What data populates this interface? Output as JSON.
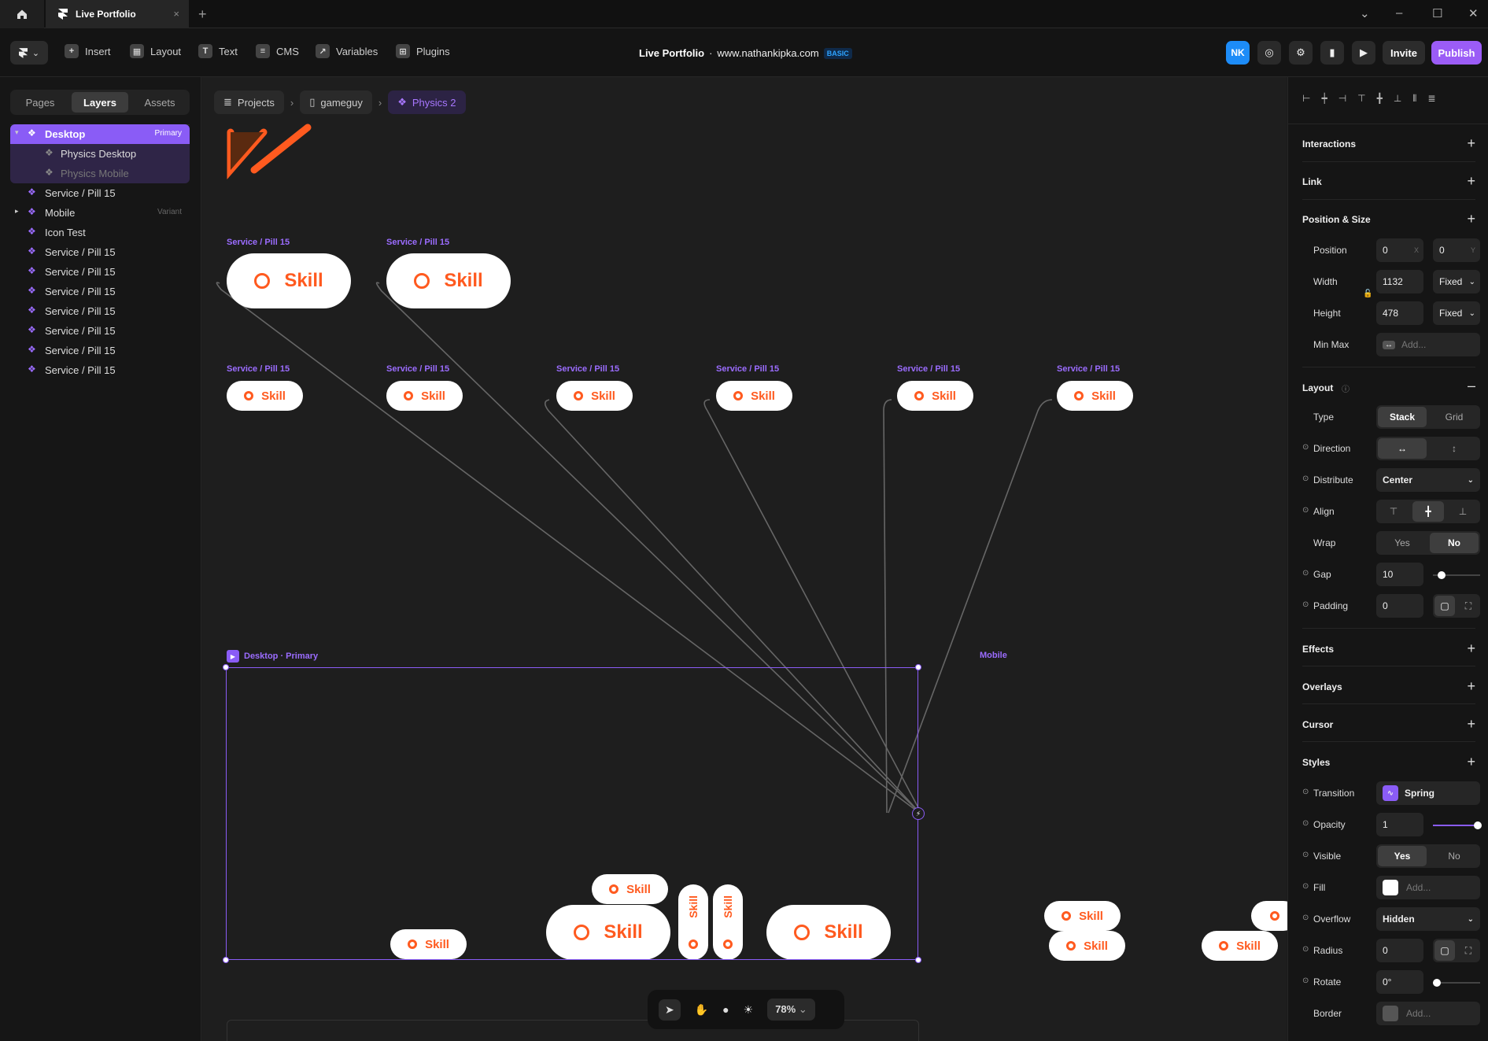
{
  "window": {
    "tab_title": "Live Portfolio",
    "tab_close": "×",
    "new_tab": "+",
    "controls": {
      "dropdown": "⌄",
      "minimize": "–",
      "maximize": "☐",
      "close": "✕"
    }
  },
  "toolbar": {
    "items": [
      {
        "label": "Insert",
        "icon": "plus-icon"
      },
      {
        "label": "Layout",
        "icon": "layout-icon"
      },
      {
        "label": "Text",
        "icon": "text-icon"
      },
      {
        "label": "CMS",
        "icon": "database-icon"
      },
      {
        "label": "Variables",
        "icon": "arrow-icon"
      },
      {
        "label": "Plugins",
        "icon": "plugins-icon"
      }
    ],
    "project_name": "Live Portfolio",
    "separator": "·",
    "domain": "www.nathankipka.com",
    "plan_badge": "BASIC",
    "avatar": "NK",
    "invite_label": "Invite",
    "publish_label": "Publish"
  },
  "left_panel": {
    "tabs": [
      "Pages",
      "Layers",
      "Assets"
    ],
    "active_tab": "Layers",
    "layers": [
      {
        "name": "Desktop",
        "tag": "Primary",
        "selected": true
      },
      {
        "name": "Physics Desktop",
        "child": true
      },
      {
        "name": "Physics Mobile",
        "child": true,
        "dim": true
      },
      {
        "name": "Service / Pill 15"
      },
      {
        "name": "Mobile",
        "tag": "Variant"
      },
      {
        "name": "Icon Test"
      },
      {
        "name": "Service / Pill 15"
      },
      {
        "name": "Service / Pill 15"
      },
      {
        "name": "Service / Pill 15"
      },
      {
        "name": "Service / Pill 15"
      },
      {
        "name": "Service / Pill 15"
      },
      {
        "name": "Service / Pill 15"
      },
      {
        "name": "Service / Pill 15"
      }
    ]
  },
  "canvas": {
    "breadcrumb": [
      "Projects",
      "gameguy",
      "Physics 2"
    ],
    "breadcrumb_sep": "›",
    "component_label": "Service / Pill 15",
    "pill_text": "Skill",
    "frame_label": "Desktop · Primary",
    "mobile_label": "Mobile",
    "zoom": "78%"
  },
  "right_panel": {
    "sections": {
      "interactions": "Interactions",
      "link": "Link",
      "position_size": "Position & Size",
      "layout": "Layout",
      "effects": "Effects",
      "overlays": "Overlays",
      "cursor": "Cursor",
      "styles": "Styles"
    },
    "position": {
      "label": "Position",
      "x": "0",
      "x_axis": "X",
      "y": "0",
      "y_axis": "Y"
    },
    "width": {
      "label": "Width",
      "value": "1132",
      "mode": "Fixed"
    },
    "height": {
      "label": "Height",
      "value": "478",
      "mode": "Fixed"
    },
    "minmax": {
      "label": "Min Max",
      "placeholder": "Add..."
    },
    "layout": {
      "type_label": "Type",
      "type_options": [
        "Stack",
        "Grid"
      ],
      "type_selected": "Stack",
      "direction_label": "Direction",
      "distribute_label": "Distribute",
      "distribute_value": "Center",
      "align_label": "Align",
      "wrap_label": "Wrap",
      "wrap_options": [
        "Yes",
        "No"
      ],
      "wrap_selected": "No",
      "gap_label": "Gap",
      "gap_value": "10",
      "padding_label": "Padding",
      "padding_value": "0"
    },
    "styles": {
      "transition_label": "Transition",
      "transition_value": "Spring",
      "opacity_label": "Opacity",
      "opacity_value": "1",
      "visible_label": "Visible",
      "visible_options": [
        "Yes",
        "No"
      ],
      "visible_selected": "Yes",
      "fill_label": "Fill",
      "fill_placeholder": "Add...",
      "overflow_label": "Overflow",
      "overflow_value": "Hidden",
      "radius_label": "Radius",
      "radius_value": "0",
      "rotate_label": "Rotate",
      "rotate_value": "0°",
      "border_label": "Border",
      "border_placeholder": "Add..."
    }
  },
  "colors": {
    "accent": "#9b5cf6",
    "brand_orange": "#ff5a1f",
    "canvas": "#1e1e1e"
  }
}
